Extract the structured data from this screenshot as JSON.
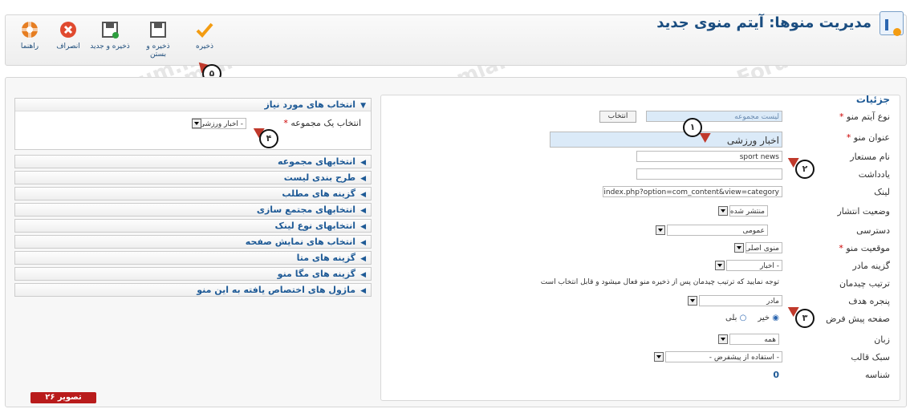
{
  "caption": "",
  "header": {
    "title": "مدیریت منوها: آیتم منوی جدید",
    "icon": "menu-manager-icon"
  },
  "toolbar": {
    "help": "راهنما",
    "cancel": "انصراف",
    "save_new": "ذخیره و جدید",
    "save_close": "ذخیره و بستن",
    "save": "ذخیره"
  },
  "form": {
    "section_title": "جزئیات",
    "rows": [
      {
        "label": "نوع آیتم منو",
        "required": true,
        "value": "لیست مجموعه",
        "button": "انتخاب"
      },
      {
        "label": "عنوان منو",
        "required": true,
        "value": "اخبار ورزشی"
      },
      {
        "label": "نام مستعار",
        "required": false,
        "value": "sport news"
      },
      {
        "label": "یادداشت",
        "required": false,
        "value": ""
      },
      {
        "label": "لینک",
        "required": false,
        "value": "index.php?option=com_content&view=category"
      },
      {
        "label": "وضعیت انتشار",
        "required": false,
        "value": "منتشر شده"
      },
      {
        "label": "دسترسی",
        "required": false,
        "value": "عمومی"
      },
      {
        "label": "موقعیت منو",
        "required": true,
        "value": "منوی اصلی"
      },
      {
        "label": "گزینه مادر",
        "required": false,
        "value": "- اخبار"
      },
      {
        "label": "ترتیب چیدمان",
        "required": false,
        "value": "توجه نمایید که ترتیب چیدمان پس از ذخیره منو فعال میشود و قابل انتخاب است"
      },
      {
        "label": "پنجره هدف",
        "required": false,
        "value": "مادر"
      },
      {
        "label": "صفحه پیش فرض",
        "required": false,
        "options": [
          "خیر",
          "بلی"
        ],
        "selected": "خیر"
      },
      {
        "label": "زبان",
        "required": false,
        "value": "همه"
      },
      {
        "label": "سبک قالب",
        "required": false,
        "value": "- استفاده از پیشفرض -"
      },
      {
        "label": "شناسه",
        "required": false,
        "value": "0"
      }
    ]
  },
  "sidebar": {
    "open_panel": {
      "title": "انتخاب های مورد نیاز",
      "field_label": "انتخاب یک مجموعه",
      "field_value": "- اخبار ورزشی"
    },
    "panels": [
      "انتخابهای مجموعه",
      "طرح بندی لیست",
      "گزینه های مطلب",
      "انتخابهای مجتمع سازی",
      "انتخابهای نوع لینک",
      "انتخاب های نمایش صفحه",
      "گزینه های متا",
      "گزینه های مگا منو",
      "ماژول های اختصاص یافته به این منو"
    ]
  },
  "markers": [
    "۱",
    "۲",
    "۳",
    "۴",
    "۵"
  ],
  "badge": "تصویر ۲۶",
  "watermark": "JoomlaForum.ir",
  "colors": {
    "accent": "#1e5a96",
    "marker_pointer": "#c0392b",
    "badge": "#b91c1c"
  }
}
